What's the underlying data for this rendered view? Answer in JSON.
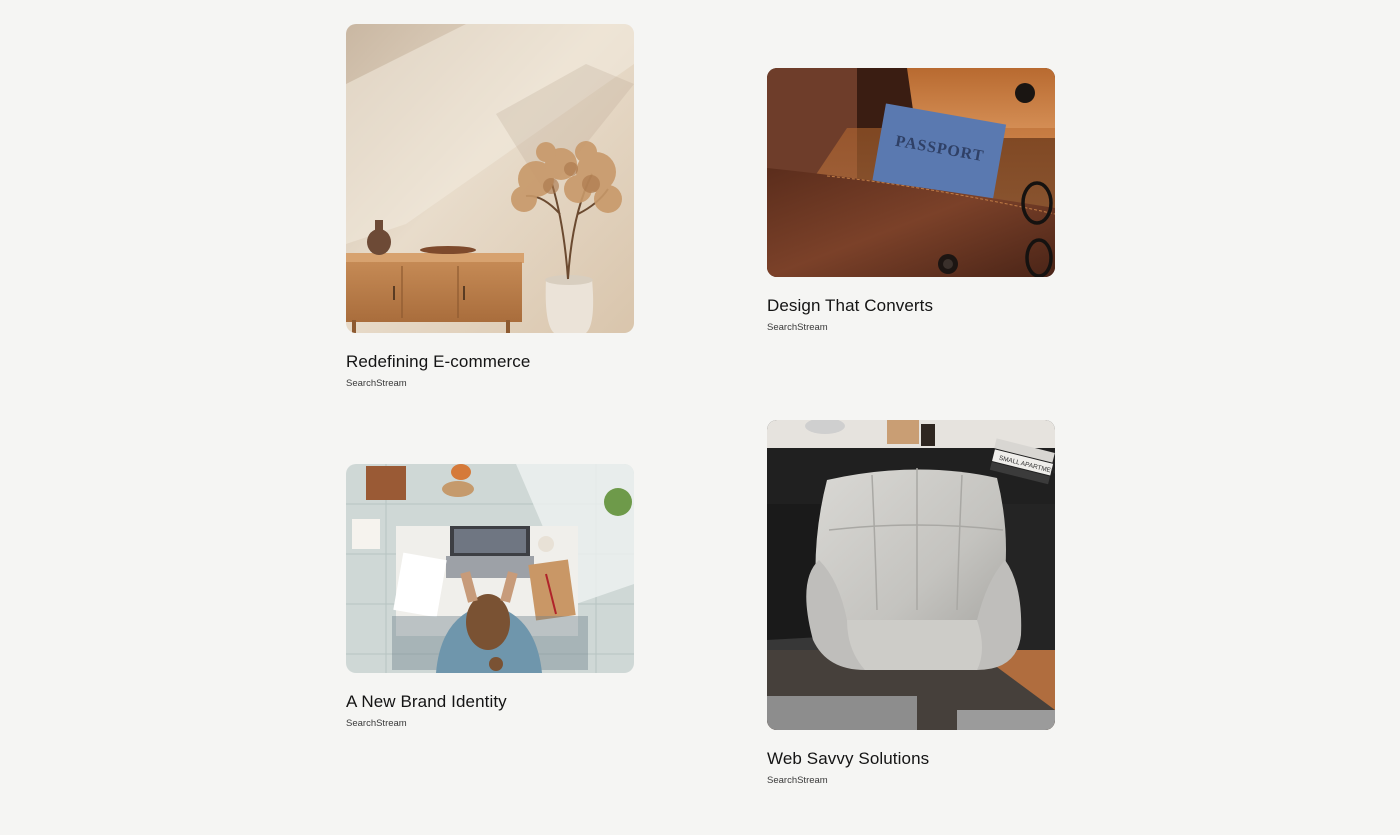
{
  "projects": [
    {
      "title": "Redefining E-commerce",
      "client": "SearchStream",
      "image": "interior-sideboard-plant-image"
    },
    {
      "title": "Design That Converts",
      "client": "SearchStream",
      "image": "leather-bag-passport-image",
      "passport_text": "PASSPORT"
    },
    {
      "title": "A New Brand Identity",
      "client": "SearchStream",
      "image": "woman-laptop-desk-image"
    },
    {
      "title": "Web Savvy Solutions",
      "client": "SearchStream",
      "image": "armchair-office-image",
      "book_text": "SMALL APARTMENT"
    }
  ]
}
